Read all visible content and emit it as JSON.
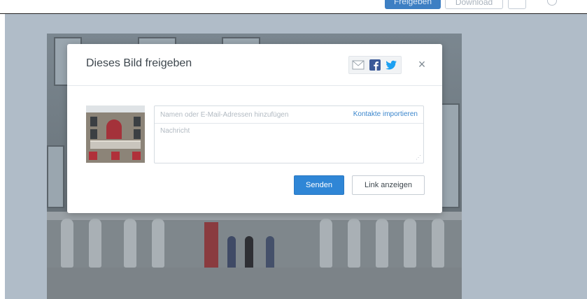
{
  "toolbar": {
    "share_label": "Freigeben",
    "download_label": "Download",
    "more_icon": "more-icon",
    "account_icon": "account-icon"
  },
  "modal": {
    "title": "Dieses Bild freigeben",
    "share_options": [
      "mail-icon",
      "facebook-icon",
      "twitter-icon"
    ],
    "close_label": "×",
    "recipients_placeholder": "Namen oder E-Mail-Adressen hinzufügen",
    "recipients_value": "",
    "import_link": "Kontakte importieren",
    "message_placeholder": "Nachricht",
    "message_value": "",
    "send_label": "Senden",
    "show_link_label": "Link anzeigen"
  },
  "colors": {
    "primary": "#2f86d6",
    "link": "#3b86cc",
    "facebook": "#3b5998",
    "twitter": "#1da1f2"
  }
}
